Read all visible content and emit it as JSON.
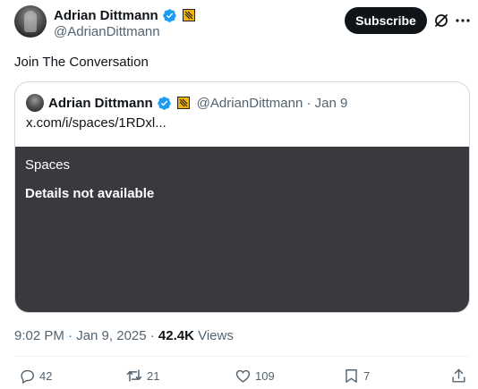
{
  "author": {
    "display_name": "Adrian Dittmann",
    "handle": "@AdrianDittmann",
    "verified_color": "#1d9bf0"
  },
  "header": {
    "subscribe_label": "Subscribe",
    "grok_icon": "grok-icon",
    "more_icon": "more-horizontal-icon"
  },
  "tweet": {
    "text": "Join The Conversation",
    "timestamp": "9:02 PM · Jan 9, 2025 · ",
    "views_count": "42.4K",
    "views_label": " Views"
  },
  "quote": {
    "display_name": "Adrian Dittmann",
    "handle_date": "@AdrianDittmann · Jan 9",
    "link_text": "x.com/i/spaces/1RDxl...",
    "spaces_label": "Spaces",
    "spaces_details": "Details not available"
  },
  "actions": {
    "replies": "42",
    "reposts": "21",
    "likes": "109",
    "bookmarks": "7"
  }
}
